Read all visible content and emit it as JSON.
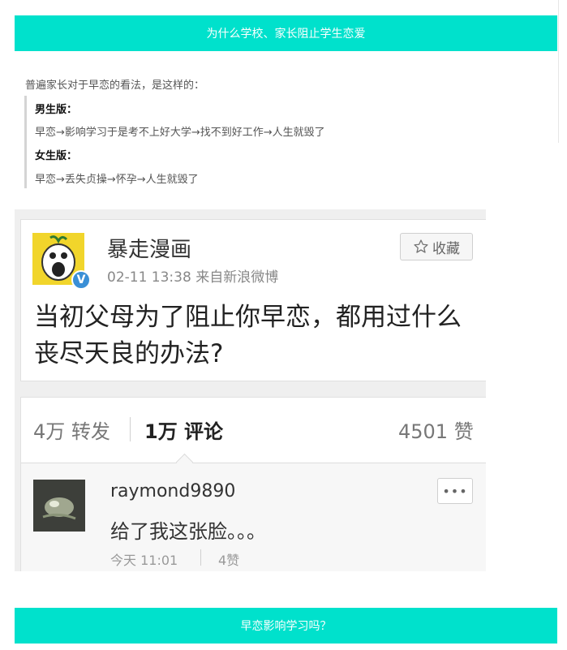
{
  "article": {
    "heading_top": "为什么学校、家长阻止学生恋爱",
    "intro": "普遍家长对于早恋的看法，是这样的：",
    "boys_label": "男生版：",
    "boys_text": "早恋→影响学习于是考不上好大学→找不到好工作→人生就毁了",
    "girls_label": "女生版：",
    "girls_text": "早恋→丢失贞操→怀孕→人生就毁了",
    "heading_bottom": "早恋影响学习吗？"
  },
  "weibo": {
    "username": "暴走漫画",
    "verified_icon": "verified-v-icon",
    "verified_mark": "V",
    "meta": "02-11 13:38  来自新浪微博",
    "favorite_label": "收藏",
    "favorite_icon": "star-outline-icon",
    "post_text": "当初父母为了阻止你早恋，都用过什么丧尽天良的办法?",
    "tabs": {
      "reposts": "4万 转发",
      "comments": "1万 评论",
      "likes": "4501 赞"
    },
    "comment": {
      "username": "raymond9890",
      "text": "给了我这张脸。。。",
      "time": "今天 11:01",
      "likes": "4赞",
      "more_label": "•••"
    }
  },
  "colors": {
    "banner_bg": "#00e1cc",
    "verified_badge": "#3a8fd6",
    "avatar_yellow": "#f1d52b"
  }
}
